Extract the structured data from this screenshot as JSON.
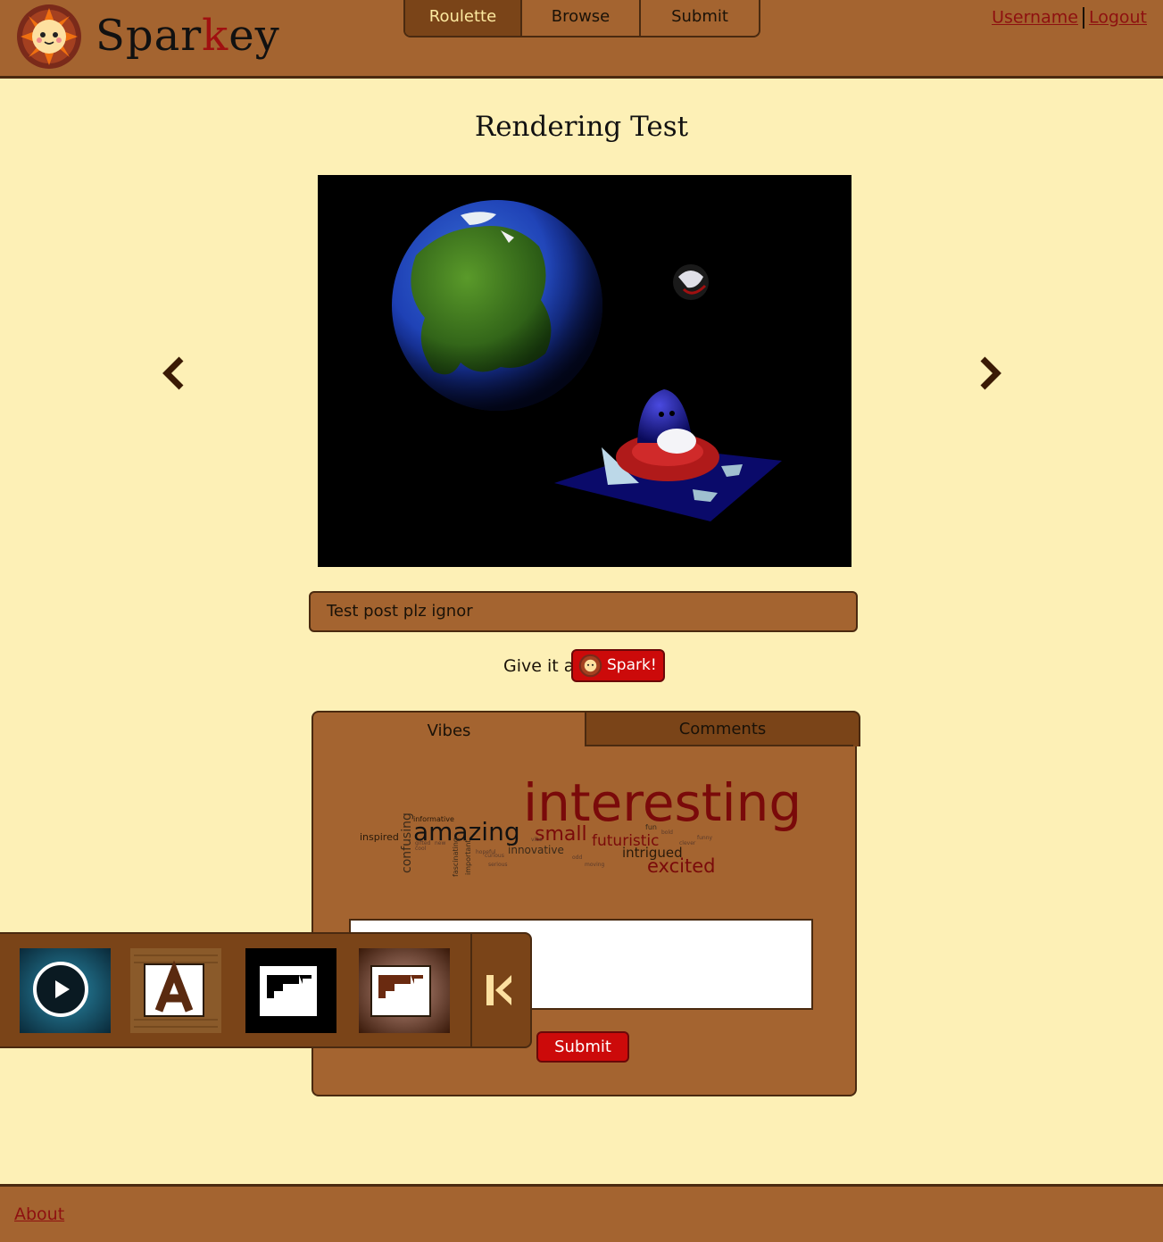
{
  "brand": {
    "name_pre": "Spar",
    "name_k": "k",
    "name_post": "ey",
    "accent_color": "#a01010"
  },
  "nav": {
    "tabs": [
      {
        "label": "Roulette",
        "active": true
      },
      {
        "label": "Browse",
        "active": false
      },
      {
        "label": "Submit",
        "active": false
      }
    ]
  },
  "user": {
    "username_label": "Username",
    "logout_label": "Logout"
  },
  "post": {
    "title": "Rendering Test",
    "caption": "Test post plz ignor",
    "give_label": "Give it a",
    "spark_label": "Spark!"
  },
  "panel": {
    "tabs": [
      {
        "label": "Vibes",
        "active": true
      },
      {
        "label": "Comments",
        "active": false
      }
    ],
    "submit_label": "Submit",
    "word_cloud": [
      {
        "word": "interesting",
        "color": "#7a0a0a"
      },
      {
        "word": "amazing",
        "color": "#111111"
      },
      {
        "word": "small",
        "color": "#7a0a0a"
      },
      {
        "word": "futuristic",
        "color": "#7a0a0a"
      },
      {
        "word": "confusing",
        "color": "#3a2a1a"
      },
      {
        "word": "excited",
        "color": "#7a0a0a"
      },
      {
        "word": "intrigued",
        "color": "#2a1a0a"
      },
      {
        "word": "innovative",
        "color": "#3a2a1a"
      },
      {
        "word": "inspired",
        "color": "#2a1a0a"
      },
      {
        "word": "informative",
        "color": "#2a1a0a"
      },
      {
        "word": "fascinating",
        "color": "#3a2a1a"
      },
      {
        "word": "important",
        "color": "#3a2a1a"
      },
      {
        "word": "fun",
        "color": "#3a2a1a"
      },
      {
        "word": "hopeful",
        "color": "#5a3a2a"
      },
      {
        "word": "curious",
        "color": "#5a3a2a"
      },
      {
        "word": "new",
        "color": "#5a3a2a"
      },
      {
        "word": "cool",
        "color": "#5a3a2a"
      },
      {
        "word": "vibe",
        "color": "#5a3a2a"
      },
      {
        "word": "gifted",
        "color": "#5a3a2a"
      },
      {
        "word": "funny",
        "color": "#5a3a2a"
      },
      {
        "word": "serious",
        "color": "#5a3a2a"
      },
      {
        "word": "odd",
        "color": "#5a3a2a"
      },
      {
        "word": "bold",
        "color": "#5a3a2a"
      },
      {
        "word": "moving",
        "color": "#5a3a2a"
      },
      {
        "word": "clever",
        "color": "#5a3a2a"
      }
    ]
  },
  "dock": {
    "tools": [
      {
        "icon": "play-icon"
      },
      {
        "icon": "text-tool-icon"
      },
      {
        "icon": "flow-tool-icon"
      },
      {
        "icon": "flow-tool-alt-icon"
      }
    ],
    "collapse_icon": "collapse-left-icon"
  },
  "footer": {
    "about_label": "About"
  },
  "colors": {
    "header_bg": "#a46430",
    "page_bg": "#fdf0b6",
    "dark_brown": "#7a4418",
    "border": "#4a2a10",
    "button_red": "#cc0a0a",
    "link": "#8e1010"
  }
}
